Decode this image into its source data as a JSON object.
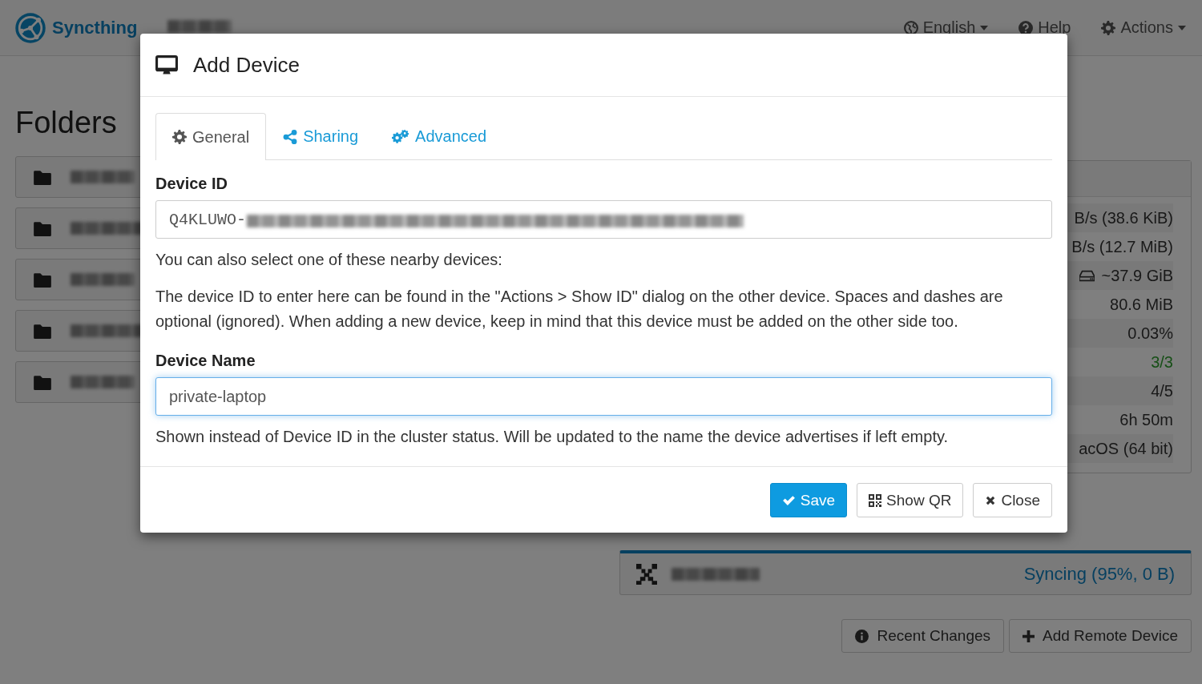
{
  "navbar": {
    "brand": "Syncthing",
    "menus": [
      {
        "label": "English",
        "dropdown": true
      },
      {
        "label": "Help",
        "dropdown": false
      },
      {
        "label": "Actions",
        "dropdown": true
      }
    ]
  },
  "folders": {
    "title": "Folders",
    "rows": [
      {
        "kind": "folder"
      },
      {
        "kind": "folder"
      },
      {
        "kind": "folder"
      },
      {
        "kind": "folder"
      },
      {
        "kind": "folder"
      }
    ]
  },
  "stats": [
    {
      "kind": "plain",
      "value": "B/s (38.6 KiB)"
    },
    {
      "kind": "plain",
      "value": "B/s (12.7 MiB)"
    },
    {
      "kind": "disk",
      "value": "~37.9 GiB"
    },
    {
      "kind": "plain",
      "value": "80.6 MiB"
    },
    {
      "kind": "plain",
      "value": "0.03%"
    },
    {
      "kind": "good",
      "value": "3/3"
    },
    {
      "kind": "plain",
      "value": "4/5"
    },
    {
      "kind": "plain",
      "value": "6h 50m"
    },
    {
      "kind": "plain",
      "value": "acOS (64 bit)"
    }
  ],
  "remote": {
    "device": {
      "status": "Syncing (95%, 0 B)"
    },
    "buttons": [
      {
        "label": "Recent Changes"
      },
      {
        "label": "Add Remote Device"
      }
    ]
  },
  "modal": {
    "title": "Add Device",
    "tabs": [
      {
        "label": "General",
        "selected": true
      },
      {
        "label": "Sharing",
        "selected": false
      },
      {
        "label": "Advanced",
        "selected": false
      }
    ],
    "device_id": {
      "label": "Device ID",
      "value": "Q4KLUWO-"
    },
    "nearby_hint": "You can also select one of these nearby devices:",
    "help": "The device ID to enter here can be found in the \"Actions > Show ID\" dialog on the other device. Spaces and dashes are optional (ignored). When adding a new device, keep in mind that this device must be added on the other side too.",
    "device_name": {
      "label": "Device Name",
      "value": "private-laptop",
      "focused": true
    },
    "name_hint": "Shown instead of Device ID in the cluster status. Will be updated to the name the device advertises if left empty.",
    "buttons": [
      {
        "label": "Save",
        "kind": "primary"
      },
      {
        "label": "Show QR",
        "kind": "default"
      },
      {
        "label": "Close",
        "kind": "default"
      }
    ]
  }
}
